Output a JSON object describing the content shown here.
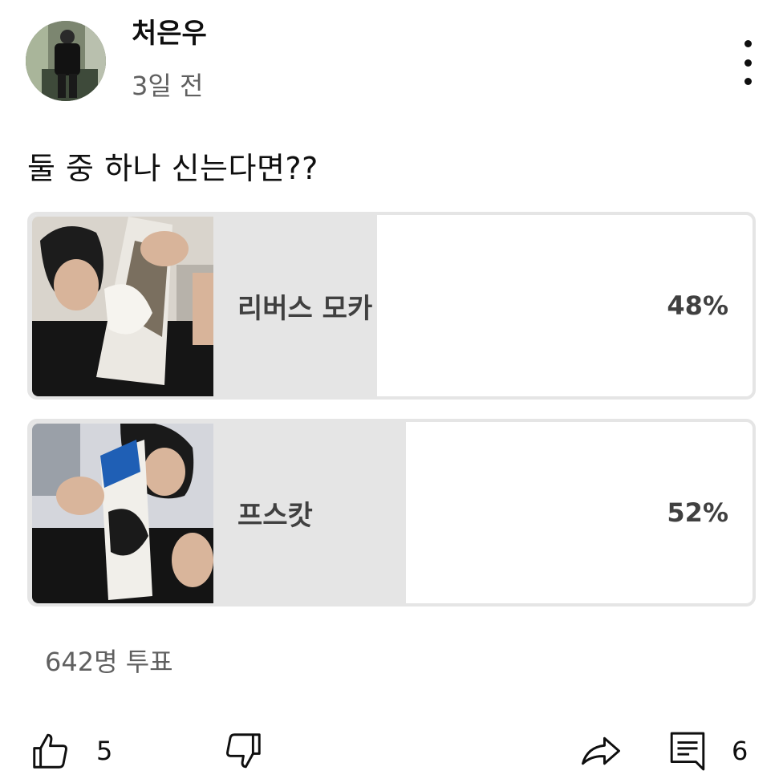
{
  "post": {
    "channel_name": "처은우",
    "time_ago": "3일 전",
    "text": "둘 중 하나 신는다면??",
    "more_icon": "more-vert-icon"
  },
  "poll": {
    "options": [
      {
        "label": "리버스 모카",
        "percent_text": "48%",
        "percent": 48,
        "image_icon": "sneaker-photo-mocha"
      },
      {
        "label": "프스캇",
        "percent_text": "52%",
        "percent": 52,
        "image_icon": "sneaker-photo-blue"
      }
    ],
    "vote_count": "642명 투표"
  },
  "actions": {
    "like_count": "5",
    "comment_count": "6",
    "icons": [
      "thumb-up-icon",
      "thumb-down-icon",
      "share-icon",
      "comment-icon"
    ]
  },
  "colors": {
    "text_primary": "#0f0f0f",
    "text_secondary": "#606060",
    "poll_fill": "#e5e5e5",
    "poll_text": "#404040"
  }
}
